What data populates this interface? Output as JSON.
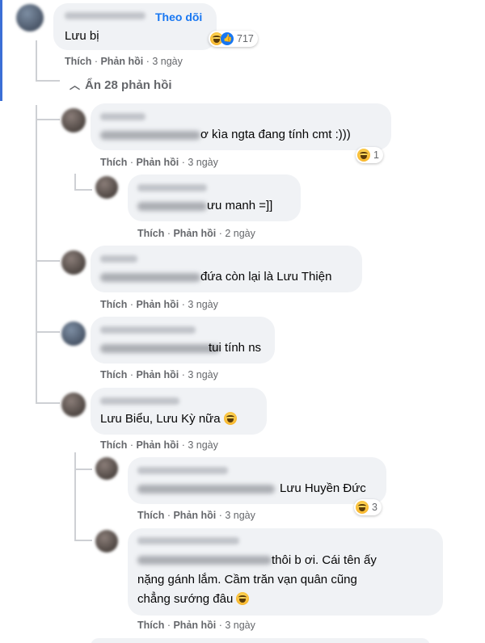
{
  "actions": {
    "like": "Thích",
    "reply": "Phản hồi"
  },
  "root": {
    "follow": "Theo dõi",
    "text": "Lưu bị",
    "reaction_count": "717",
    "time": "3 ngày"
  },
  "hide_replies": "Ẩn 28 phản hồi",
  "replies": [
    {
      "text": "ơ kìa ngta đang tính cmt :)))",
      "reaction_count": "1",
      "time": "3 ngày"
    },
    {
      "text": "ưu manh =]]",
      "time": "2 ngày"
    },
    {
      "text": "đứa còn lại là Lưu Thiện",
      "time": "3 ngày"
    },
    {
      "text": "tui tính ns",
      "time": "3 ngày"
    },
    {
      "text": "Lưu Biểu, Lưu Kỳ nữa",
      "time": "3 ngày"
    },
    {
      "text": "Lưu Huyền Đức",
      "reaction_count": "3",
      "time": "3 ngày"
    },
    {
      "line1": "thôi b ơi. Cái tên ấy",
      "line2": "nặng gánh lắm. Cầm trăn vạn quân cũng",
      "line3": "chẳng sướng đâu",
      "time": "3 ngày"
    }
  ],
  "colors": {
    "accent": "#1877f2",
    "bubble": "#f0f2f5",
    "meta": "#65676b"
  }
}
